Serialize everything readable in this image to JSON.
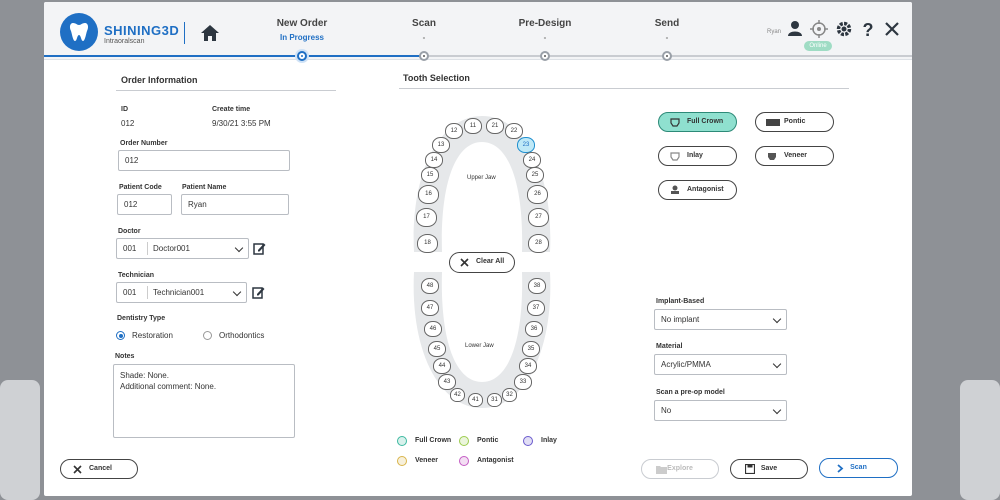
{
  "header": {
    "brand": "SHINING3D",
    "brand_sub": "Intraoralscan",
    "steps": [
      {
        "title": "New Order",
        "status": "In Progress"
      },
      {
        "title": "Scan",
        "status": "-"
      },
      {
        "title": "Pre-Design",
        "status": "-"
      },
      {
        "title": "Send",
        "status": "-"
      }
    ],
    "user": "Ryan",
    "online": "Online"
  },
  "order": {
    "section_title": "Order Information",
    "id_label": "ID",
    "id_value": "012",
    "create_time_label": "Create time",
    "create_time_value": "9/30/21 3:55 PM",
    "order_number_label": "Order Number",
    "order_number_value": "012",
    "patient_code_label": "Patient Code",
    "patient_code_value": "012",
    "patient_name_label": "Patient Name",
    "patient_name_value": "Ryan",
    "doctor_label": "Doctor",
    "doctor_code": "001",
    "doctor_value": "Doctor001",
    "technician_label": "Technician",
    "technician_code": "001",
    "technician_value": "Technician001",
    "dentistry_type_label": "Dentistry Type",
    "dentistry_options": [
      "Restoration",
      "Orthodontics"
    ],
    "dentistry_selected": "Restoration",
    "notes_label": "Notes",
    "notes_line1": "Shade: None.",
    "notes_line2": "Additional comment: None."
  },
  "tooth_selection": {
    "section_title": "Tooth Selection",
    "upper_jaw_label": "Upper Jaw",
    "lower_jaw_label": "Lower Jaw",
    "clear_all": "Clear All",
    "upper_teeth": [
      "18",
      "17",
      "16",
      "15",
      "14",
      "13",
      "12",
      "11",
      "21",
      "22",
      "23",
      "24",
      "25",
      "26",
      "27",
      "28"
    ],
    "lower_teeth": [
      "48",
      "47",
      "46",
      "45",
      "44",
      "43",
      "42",
      "41",
      "31",
      "32",
      "33",
      "34",
      "35",
      "36",
      "37",
      "38"
    ],
    "selected_tooth": "23",
    "restoration_types": [
      "Full Crown",
      "Pontic",
      "Inlay",
      "Veneer",
      "Antagonist"
    ],
    "selected_type": "Full Crown",
    "legend": [
      {
        "label": "Full Crown",
        "color": "#3db9a0"
      },
      {
        "label": "Pontic",
        "color": "#9ccc4e"
      },
      {
        "label": "Inlay",
        "color": "#6a5acd"
      },
      {
        "label": "Veneer",
        "color": "#d9b44a"
      },
      {
        "label": "Antagonist",
        "color": "#c45cc4"
      }
    ]
  },
  "options": {
    "implant_label": "Implant-Based",
    "implant_value": "No implant",
    "material_label": "Material",
    "material_value": "Acrylic/PMMA",
    "preop_label": "Scan a pre-op model",
    "preop_value": "No"
  },
  "footer": {
    "cancel": "Cancel",
    "explore": "Explore",
    "save": "Save",
    "scan": "Scan"
  }
}
